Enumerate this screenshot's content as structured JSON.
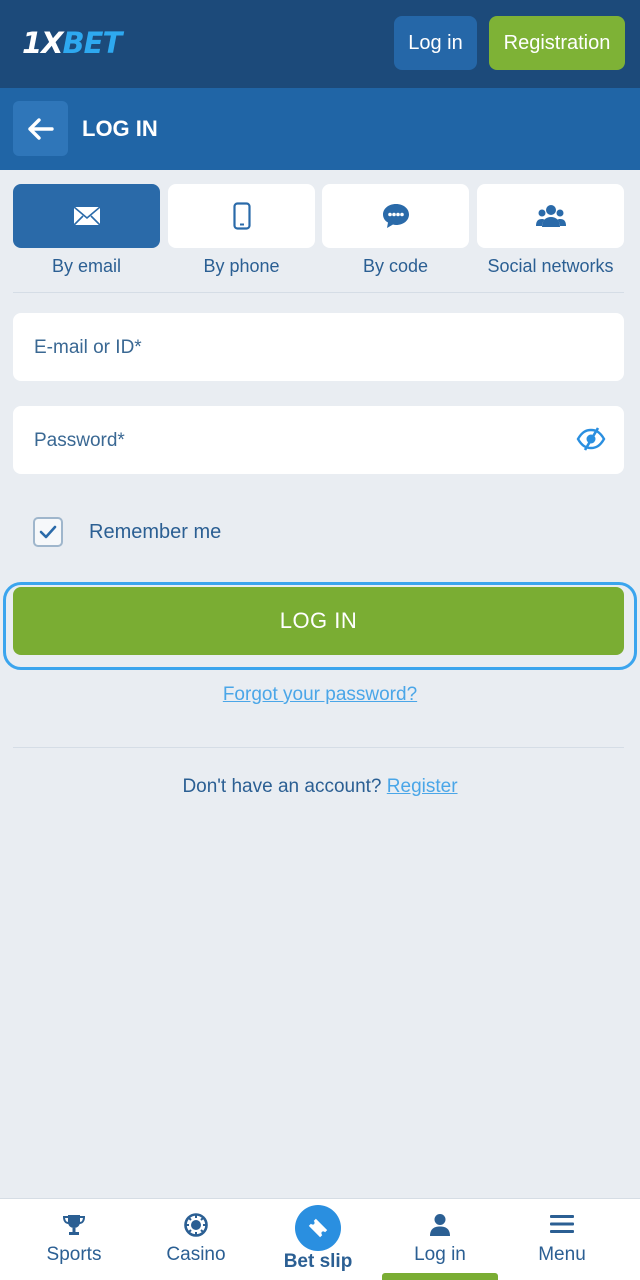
{
  "header": {
    "logo_prefix": "1X",
    "logo_suffix": "BET",
    "login_label": "Log in",
    "registration_label": "Registration"
  },
  "subheader": {
    "title": "LOG IN",
    "back_icon": "arrow-left-icon"
  },
  "login_methods": [
    {
      "label": "By email",
      "icon": "envelope-icon",
      "active": true
    },
    {
      "label": "By phone",
      "icon": "phone-icon",
      "active": false
    },
    {
      "label": "By code",
      "icon": "chat-icon",
      "active": false
    },
    {
      "label": "Social networks",
      "icon": "users-icon",
      "active": false
    }
  ],
  "form": {
    "email_placeholder": "E-mail or ID*",
    "password_placeholder": "Password*",
    "remember_label": "Remember me",
    "remember_checked": true,
    "submit_label": "LOG IN",
    "forgot_label": "Forgot your password?",
    "no_account_text": "Don't have an account?",
    "register_link": "Register"
  },
  "bottom_nav": [
    {
      "label": "Sports",
      "icon": "trophy-icon"
    },
    {
      "label": "Casino",
      "icon": "casino-chip-icon"
    },
    {
      "label": "Bet slip",
      "icon": "ticket-icon"
    },
    {
      "label": "Log in",
      "icon": "user-icon",
      "active": true
    },
    {
      "label": "Menu",
      "icon": "menu-icon"
    }
  ],
  "colors": {
    "header_bg": "#1c4a7a",
    "subheader_bg": "#2065a6",
    "accent_green": "#7aad33",
    "link_blue": "#4aa6e8"
  }
}
